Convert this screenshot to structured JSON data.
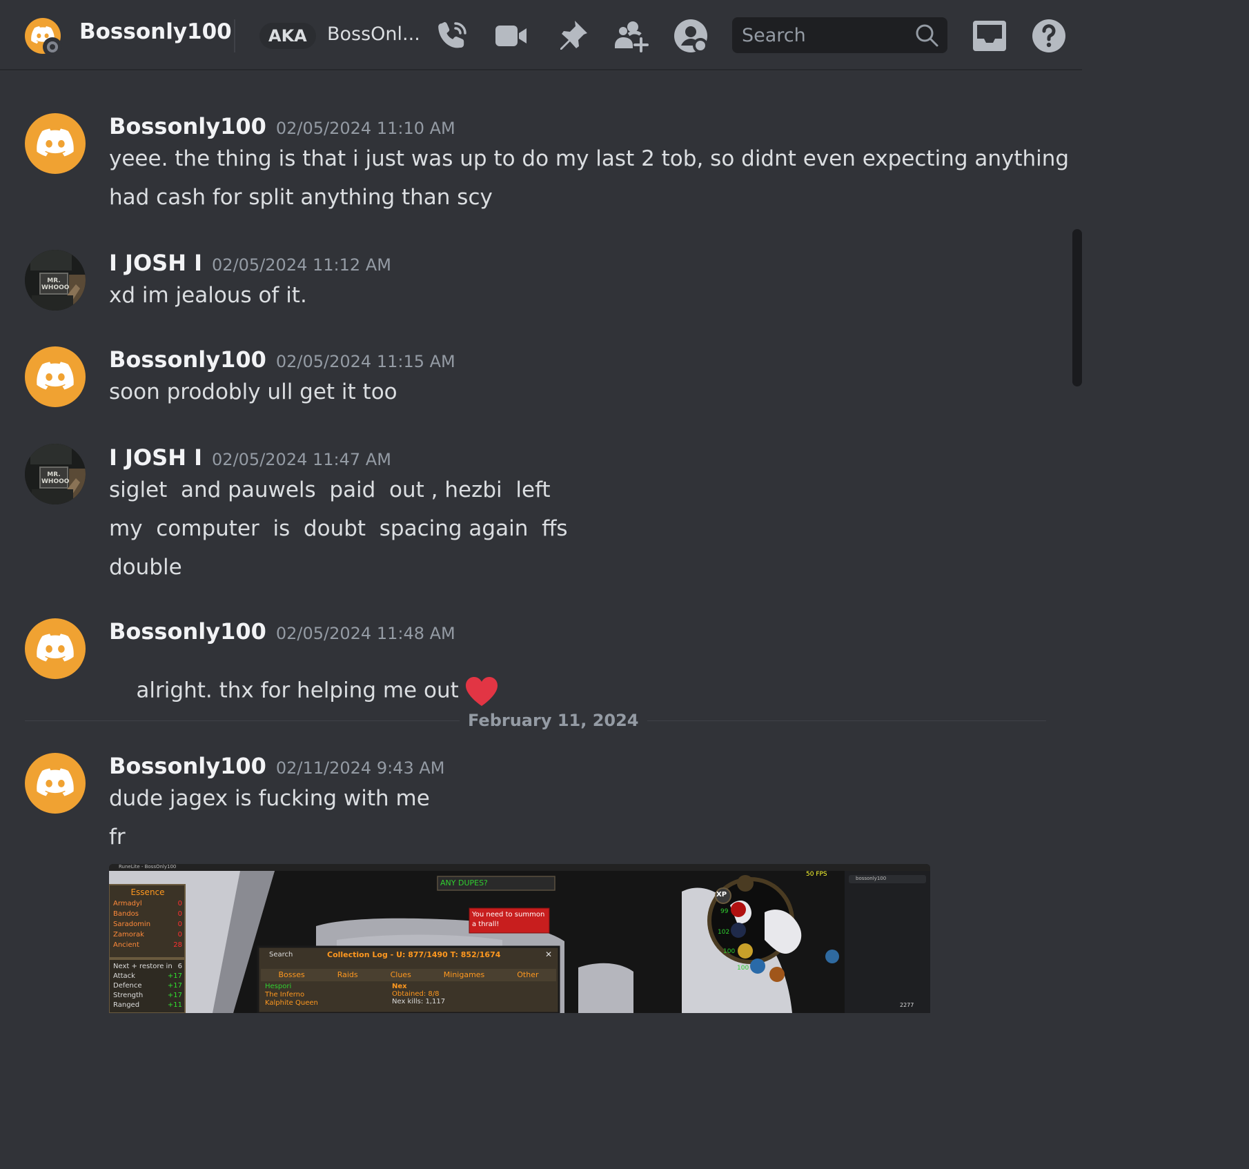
{
  "header": {
    "name": "Bossonly100",
    "aka_badge": "AKA",
    "aka_name": "BossOnl...",
    "search_placeholder": "Search"
  },
  "messages": [
    {
      "author": "Bossonly100",
      "timestamp": "02/05/2024 11:10 AM",
      "avatar": "discord-logo",
      "lines": [
        "yeee. the thing is that i just was up to do my last 2 tob, so didnt even expecting anything",
        "had cash for split anything than scy"
      ]
    },
    {
      "author": "I JOSH I",
      "timestamp": "02/05/2024 11:12 AM",
      "avatar": "photo",
      "lines": [
        "xd im jealous of it."
      ]
    },
    {
      "author": "Bossonly100",
      "timestamp": "02/05/2024 11:15 AM",
      "avatar": "discord-logo",
      "lines": [
        "soon prodobly ull get it too"
      ]
    },
    {
      "author": "I JOSH I",
      "timestamp": "02/05/2024 11:47 AM",
      "avatar": "photo",
      "lines": [
        "siglet  and pauwels  paid  out , hezbi  left",
        "my  computer  is  doubt  spacing again  ffs",
        "double"
      ]
    },
    {
      "author": "Bossonly100",
      "timestamp": "02/05/2024 11:48 AM",
      "avatar": "discord-logo",
      "lines": [
        "alright. thx for helping me out"
      ]
    },
    {
      "author": "Bossonly100",
      "timestamp": "02/11/2024 9:43 AM",
      "avatar": "discord-logo",
      "lines": [
        "dude jagex is fucking with me",
        "fr"
      ]
    }
  ],
  "date_divider": "February 11, 2024",
  "avatar_sign": "MR. WHOOO",
  "attachment": {
    "window_title": "RuneLite - BossOnly100",
    "essence_title": "Essence",
    "essence_rows": [
      {
        "name": "Armadyl",
        "value": "0"
      },
      {
        "name": "Bandos",
        "value": "0"
      },
      {
        "name": "Saradomin",
        "value": "0"
      },
      {
        "name": "Zamorak",
        "value": "0"
      },
      {
        "name": "Ancient",
        "value": "28"
      }
    ],
    "boosts": [
      {
        "name": "Next + restore in",
        "value": "6"
      },
      {
        "name": "Attack",
        "value": "+17"
      },
      {
        "name": "Defence",
        "value": "+17"
      },
      {
        "name": "Strength",
        "value": "+17"
      },
      {
        "name": "Ranged",
        "value": "+11"
      }
    ],
    "chat_box": "ANY DUPES?",
    "warning": "You need to summon a thrall!",
    "log_search": "Search",
    "log_title": "Collection Log - U: 877/1490 T: 852/1674",
    "log_tabs": [
      "Bosses",
      "Raids",
      "Clues",
      "Minigames",
      "Other"
    ],
    "log_list": [
      "Hespori",
      "The Inferno",
      "Kalphite Queen"
    ],
    "log_entry": "Nex",
    "log_obtained": "Obtained: 8/8",
    "log_kills": "Nex kills: 1,117",
    "orb_xp": "XP",
    "orb_values": [
      "99",
      "102",
      "100",
      "100"
    ],
    "fps": "50 FPS",
    "sidebar_search": "bossonly100",
    "total_level": "2277"
  },
  "colors": {
    "bg": "#313338",
    "header_border": "#26282c",
    "brand_orange": "#f0a232",
    "heart": "#e23544"
  }
}
